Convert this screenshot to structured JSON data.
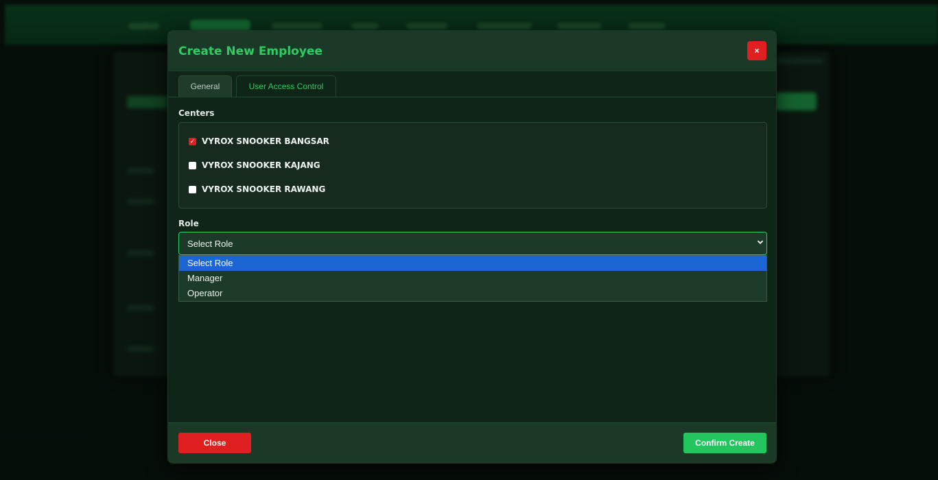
{
  "modal": {
    "title": "Create New Employee",
    "close_icon": "close-icon",
    "close_glyph": "×"
  },
  "tabs": [
    {
      "label": "General",
      "active": false
    },
    {
      "label": "User Access Control",
      "active": true
    }
  ],
  "centers": {
    "label": "Centers",
    "items": [
      {
        "name": "VYROX SNOOKER BANGSAR",
        "checked": true
      },
      {
        "name": "VYROX SNOOKER KAJANG",
        "checked": false
      },
      {
        "name": "VYROX SNOOKER RAWANG",
        "checked": false
      }
    ]
  },
  "role": {
    "label": "Role",
    "selected": "Select Role",
    "chevron_icon": "chevron-down-icon",
    "options": [
      "Select Role",
      "Manager",
      "Operator"
    ],
    "highlighted_index": 0
  },
  "footer": {
    "close_label": "Close",
    "confirm_label": "Confirm Create"
  },
  "colors": {
    "accent": "#2ecc63",
    "danger": "#e02020",
    "confirm": "#22c55e",
    "option_highlight": "#1c66d4"
  }
}
